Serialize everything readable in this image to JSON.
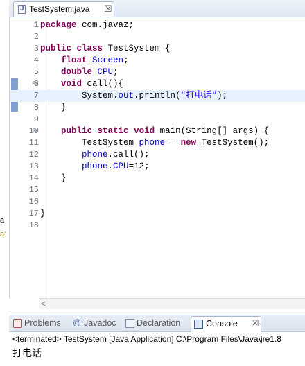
{
  "editor": {
    "tab_title": "TestSystem.java",
    "close_glyph": "☒"
  },
  "code_lines": [
    {
      "num": "1",
      "text": "package com.javaz;"
    },
    {
      "num": "2",
      "text": ""
    },
    {
      "num": "3",
      "text": "public class TestSystem {"
    },
    {
      "num": "4",
      "text": "    float Screen;"
    },
    {
      "num": "5",
      "text": "    double CPU;"
    },
    {
      "num": "6",
      "text": "    void call(){",
      "fold": "⊖"
    },
    {
      "num": "7",
      "text": "        System.out.println(\"打电话\");",
      "current": true
    },
    {
      "num": "8",
      "text": "    }"
    },
    {
      "num": "9",
      "text": ""
    },
    {
      "num": "10",
      "text": "    public static void main(String[] args) {",
      "fold": "⊖"
    },
    {
      "num": "11",
      "text": "        TestSystem phone = new TestSystem();"
    },
    {
      "num": "12",
      "text": "        phone.call();"
    },
    {
      "num": "13",
      "text": "        phone.CPU=12;"
    },
    {
      "num": "14",
      "text": "    }"
    },
    {
      "num": "15",
      "text": ""
    },
    {
      "num": "16",
      "text": ""
    },
    {
      "num": "17",
      "text": "}"
    },
    {
      "num": "18",
      "text": ""
    }
  ],
  "scrollbar": {
    "left_arrow": "<"
  },
  "views": {
    "problems": "Problems",
    "javadoc": "Javadoc",
    "javadoc_icon": "@",
    "declaration": "Declaration",
    "console": "Console",
    "close_glyph": "☒"
  },
  "console": {
    "header": "<terminated> TestSystem [Java Application] C:\\Program Files\\Java\\jre1.8",
    "output": "打电话"
  },
  "left_view_fragments": [
    "a",
    "a'"
  ],
  "colors": {
    "keyword": "#7f0055",
    "field": "#0000c0",
    "string": "#2a00ff",
    "current_line": "#e8f2fe"
  }
}
